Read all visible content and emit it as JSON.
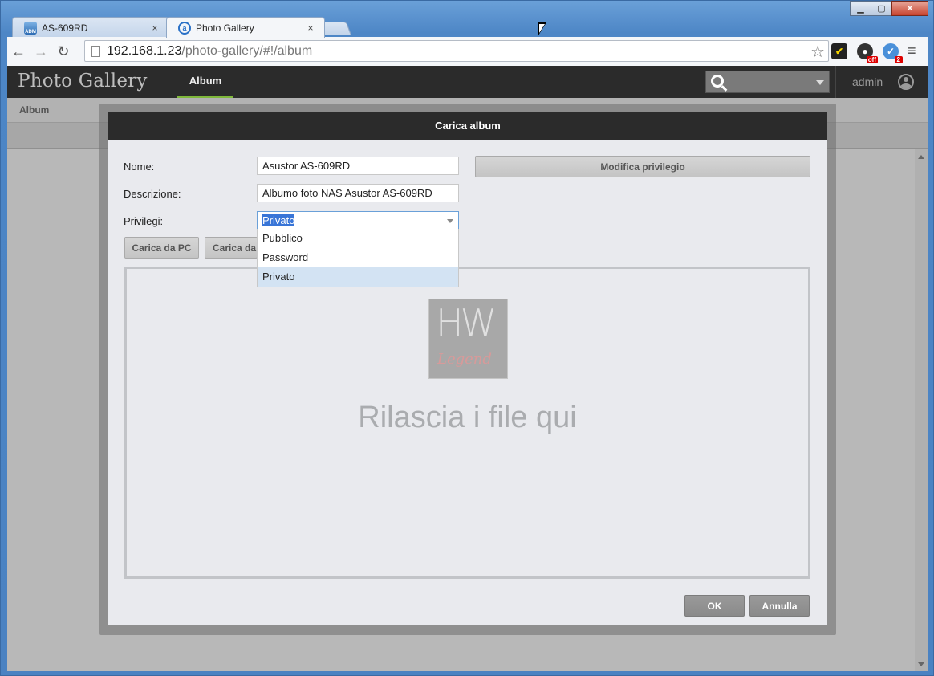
{
  "browser": {
    "tabs": [
      {
        "title": "AS-609RD",
        "favicon": "adm-icon",
        "close": "×"
      },
      {
        "title": "Photo Gallery",
        "favicon": "photo-gallery-icon",
        "close": "×"
      }
    ],
    "url_host": "192.168.1.23",
    "url_path": "/photo-gallery/#!/album",
    "extensions": {
      "ghostery_badge": "off",
      "shield_badge": "2"
    }
  },
  "app": {
    "title": "Photo Gallery",
    "nav_album": "Album",
    "user": "admin",
    "breadcrumb": "Album"
  },
  "dialog": {
    "title": "Carica album",
    "name_label": "Nome:",
    "name_value": "Asustor AS-609RD",
    "description_label": "Descrizione:",
    "description_value": "Albumo foto NAS Asustor AS-609RD",
    "privileges_label": "Privilegi:",
    "privileges_value": "Privato",
    "privileges_options": [
      "Pubblico",
      "Password",
      "Privato"
    ],
    "modify_privilege_button": "Modifica privilegio",
    "upload_pc_button": "Carica da PC",
    "upload_other_button": "Carica da",
    "logo_letters": "HW",
    "logo_sub": "Legend",
    "drop_text": "Rilascia i file qui",
    "ok_button": "OK",
    "cancel_button": "Annulla"
  }
}
